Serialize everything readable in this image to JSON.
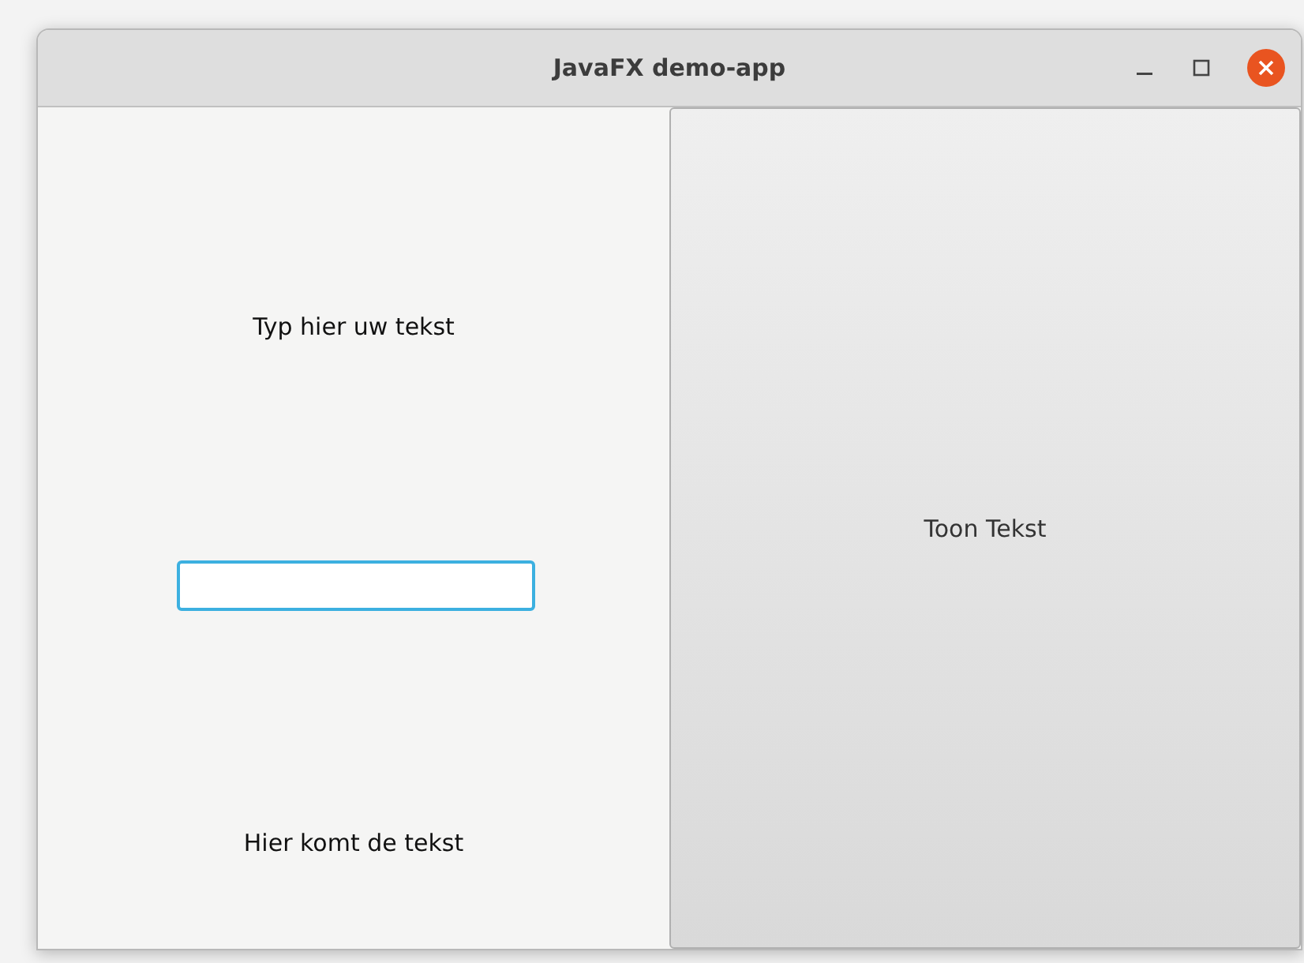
{
  "window": {
    "title": "JavaFX demo-app"
  },
  "prompt_label": "Typ hier uw tekst",
  "text_field": {
    "focused": true
  },
  "output_label": "Hier komt de tekst",
  "show_button": {
    "label": "Toon Tekst"
  }
}
